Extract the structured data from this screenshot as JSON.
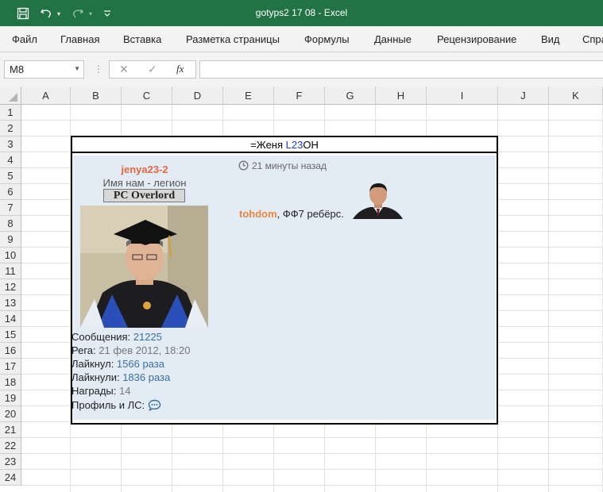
{
  "window": {
    "title": "gotyps2 17 08  -  Excel"
  },
  "ribbon": {
    "tabs": [
      "Файл",
      "Главная",
      "Вставка",
      "Разметка страницы",
      "Формулы",
      "Данные",
      "Рецензирование",
      "Вид",
      "Спра"
    ]
  },
  "formula_bar": {
    "name_box": "M8",
    "fx_label": "fx",
    "value": ""
  },
  "columns": [
    "A",
    "B",
    "C",
    "D",
    "E",
    "F",
    "G",
    "H",
    "I",
    "J",
    "K"
  ],
  "rows": [
    "1",
    "2",
    "3",
    "4",
    "5",
    "6",
    "7",
    "8",
    "9",
    "10",
    "11",
    "12",
    "13",
    "14",
    "15",
    "16",
    "17",
    "18",
    "19",
    "20",
    "21",
    "22",
    "23",
    "24"
  ],
  "cell_b3": {
    "prefix": "=Женя ",
    "ref": "L23",
    "suffix": "ОН"
  },
  "post": {
    "username": "jenya23-2",
    "user_title": "Имя нам - легион",
    "rank": "PC Overlord",
    "stats": [
      {
        "label": "Сообщения: ",
        "value": "21225",
        "style": "v"
      },
      {
        "label": "Рега: ",
        "value": "21 фев 2012, 18:20",
        "style": "g"
      },
      {
        "label": "Лайкнул: ",
        "value": "1566 раза",
        "style": "v"
      },
      {
        "label": "Лайкнули: ",
        "value": "1836 раза",
        "style": "v"
      },
      {
        "label": "Награды: ",
        "value": "14",
        "style": "g"
      },
      {
        "label": "Профиль и ЛС: ",
        "value": "",
        "style": "v"
      }
    ],
    "time": "21 минуты назад",
    "reply_nick": "tohdom",
    "reply_text": ", ФФ7 ребёрс."
  },
  "colors": {
    "excel_green": "#217346",
    "post_bg": "#e3ecf5",
    "nick_orange": "#e8663d",
    "link_blue": "#3b6ea5"
  }
}
